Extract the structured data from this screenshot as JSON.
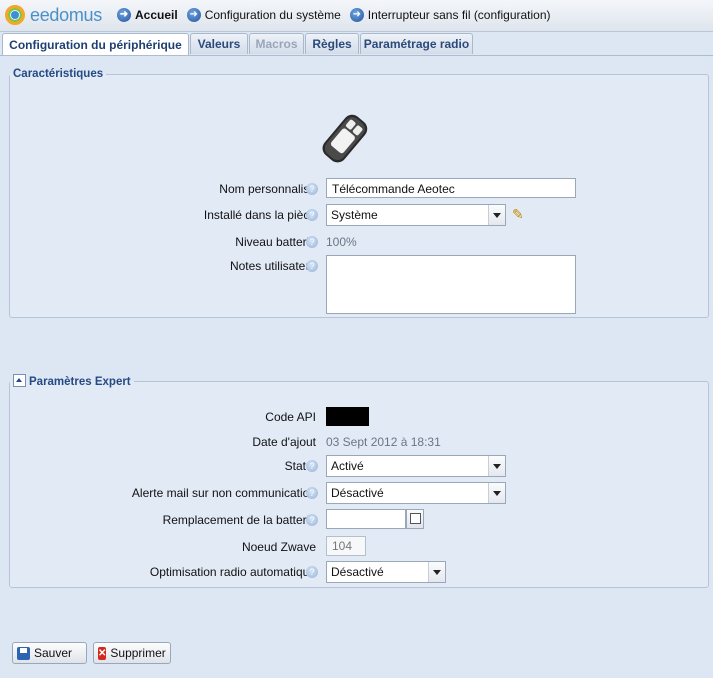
{
  "app": {
    "logo_text": "eedomus"
  },
  "breadcrumb": [
    {
      "label": "Accueil"
    },
    {
      "label": "Configuration du système"
    },
    {
      "label": "Interrupteur sans fil (configuration)"
    }
  ],
  "tabs": [
    {
      "label": "Configuration du périphérique",
      "state": "active"
    },
    {
      "label": "Valeurs",
      "state": "normal"
    },
    {
      "label": "Macros",
      "state": "disabled"
    },
    {
      "label": "Règles",
      "state": "normal"
    },
    {
      "label": "Paramétrage radio",
      "state": "normal"
    }
  ],
  "characteristics": {
    "legend": "Caractéristiques",
    "device_icon": "remote-control-icon",
    "custom_name_label": "Nom personnalisé",
    "custom_name_value": "Télécommande Aeotec",
    "room_label": "Installé dans la pièce",
    "room_value": "Système",
    "battery_label": "Niveau batterie",
    "battery_value": "100%",
    "notes_label": "Notes utilisateur",
    "notes_value": ""
  },
  "expert": {
    "legend": "Paramètres Expert",
    "api_code_label": "Code API",
    "date_added_label": "Date d'ajout",
    "date_added_value": "03 Sept 2012 à 18:31",
    "status_label": "Statut",
    "status_value": "Activé",
    "mail_alert_label": "Alerte mail sur non communication",
    "mail_alert_value": "Désactivé",
    "battery_replacement_label": "Remplacement de la batterie",
    "battery_replacement_value": "",
    "zwave_node_label": "Noeud Zwave",
    "zwave_node_value": "104",
    "radio_opt_label": "Optimisation radio automatique",
    "radio_opt_value": "Désactivé"
  },
  "buttons": {
    "save": "Sauver",
    "delete": "Supprimer"
  },
  "colors": {
    "background": "#dde6f3",
    "legend_text": "#254a84",
    "tab_text": "#2b4a7a"
  }
}
